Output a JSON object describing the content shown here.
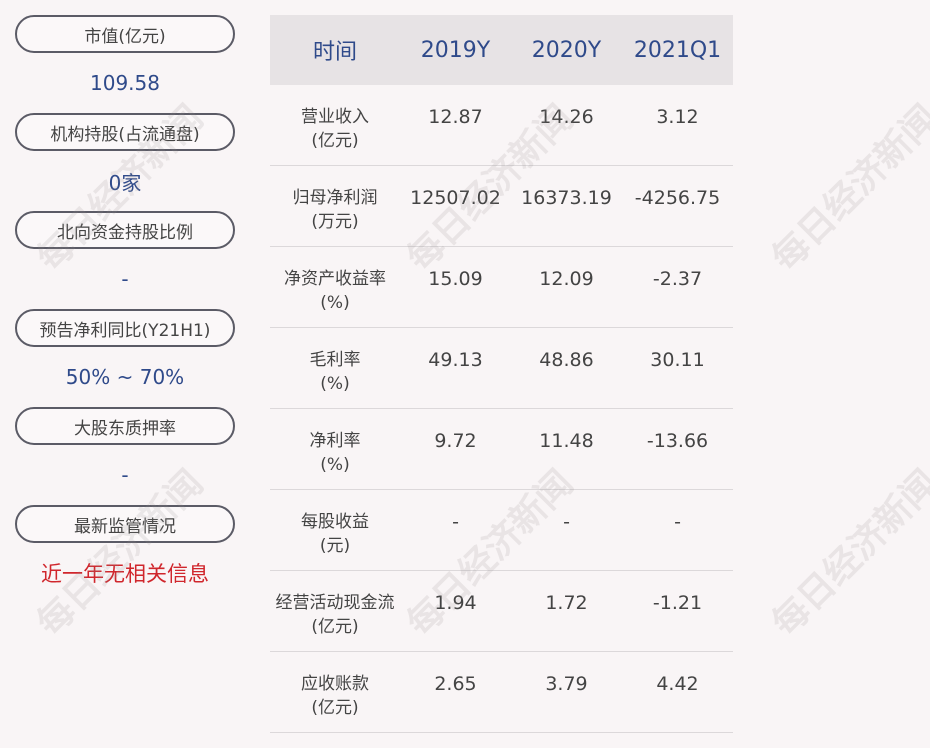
{
  "summary": [
    {
      "label": "市值(亿元)",
      "value": "109.58",
      "highlight": false
    },
    {
      "label": "机构持股(占流通盘)",
      "value": "0家",
      "highlight": false
    },
    {
      "label": "北向资金持股比例",
      "value": "-",
      "highlight": false
    },
    {
      "label": "预告净利同比(Y21H1)",
      "value": "50% ~ 70%",
      "highlight": false
    },
    {
      "label": "大股东质押率",
      "value": "-",
      "highlight": false
    },
    {
      "label": "最新监管情况",
      "value": "近一年无相关信息",
      "highlight": true
    }
  ],
  "table": {
    "headers": [
      "时间",
      "2019Y",
      "2020Y",
      "2021Q1"
    ],
    "rows": [
      {
        "name": "营业收入",
        "unit": "(亿元)",
        "values": [
          "12.87",
          "14.26",
          "3.12"
        ]
      },
      {
        "name": "归母净利润",
        "unit": "(万元)",
        "values": [
          "12507.02",
          "16373.19",
          "-4256.75"
        ]
      },
      {
        "name": "净资产收益率",
        "unit": "(%)",
        "values": [
          "15.09",
          "12.09",
          "-2.37"
        ]
      },
      {
        "name": "毛利率",
        "unit": "(%)",
        "values": [
          "49.13",
          "48.86",
          "30.11"
        ]
      },
      {
        "name": "净利率",
        "unit": "(%)",
        "values": [
          "9.72",
          "11.48",
          "-13.66"
        ]
      },
      {
        "name": "每股收益",
        "unit": "(元)",
        "values": [
          "-",
          "-",
          "-"
        ]
      },
      {
        "name": "经营活动现金流",
        "unit": "(亿元)",
        "values": [
          "1.94",
          "1.72",
          "-1.21"
        ]
      },
      {
        "name": "应收账款",
        "unit": "(亿元)",
        "values": [
          "2.65",
          "3.79",
          "4.42"
        ]
      }
    ]
  },
  "watermark": "每日经济新闻",
  "colors": {
    "accent": "#2f4a8a",
    "alert": "#d0262c",
    "header_bg": "#e7e3e5"
  }
}
